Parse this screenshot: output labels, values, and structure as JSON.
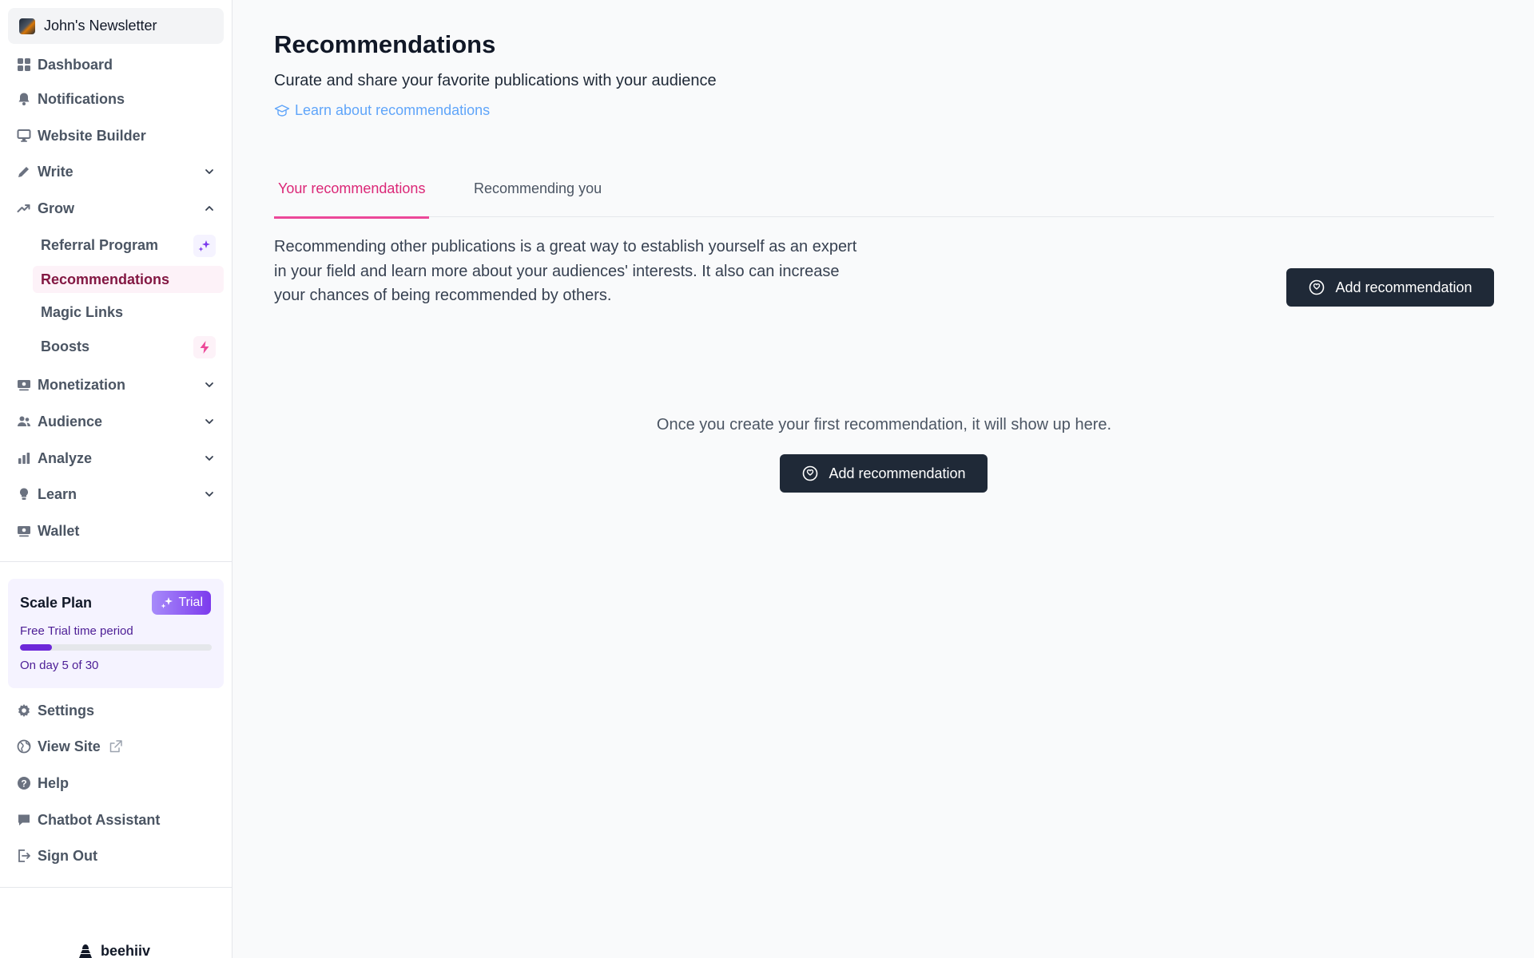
{
  "sidebar": {
    "publication": "John's Newsletter",
    "nav": {
      "dashboard": "Dashboard",
      "notifications": "Notifications",
      "website_builder": "Website Builder",
      "write": "Write",
      "grow": "Grow",
      "monetization": "Monetization",
      "audience": "Audience",
      "analyze": "Analyze",
      "learn": "Learn",
      "wallet": "Wallet"
    },
    "grow_items": {
      "referral": "Referral Program",
      "recommendations": "Recommendations",
      "magic_links": "Magic Links",
      "boosts": "Boosts"
    },
    "plan": {
      "title": "Scale Plan",
      "badge": "Trial",
      "subtitle": "Free Trial time period",
      "progress_fraction": 0.1667,
      "day_text": "On day 5 of 30"
    },
    "bottom": {
      "settings": "Settings",
      "view_site": "View Site",
      "help": "Help",
      "chatbot": "Chatbot Assistant",
      "sign_out": "Sign Out"
    },
    "brand": "beehiiv"
  },
  "main": {
    "title": "Recommendations",
    "subtitle": "Curate and share your favorite publications with your audience",
    "learn_link": "Learn about recommendations",
    "tabs": [
      "Your recommendations",
      "Recommending you"
    ],
    "intro": "Recommending other publications is a great way to establish yourself as an expert in your field and learn more about your audiences' interests. It also can increase your chances of being recommended by others.",
    "add_button": "Add recommendation",
    "empty_text": "Once you create your first recommendation, it will show up here.",
    "empty_button": "Add recommendation"
  },
  "colors": {
    "accent_pink": "#ec4899",
    "button_dark": "#1f2937",
    "plan_purple": "#6d28d9",
    "link_blue": "#60a5fa"
  }
}
